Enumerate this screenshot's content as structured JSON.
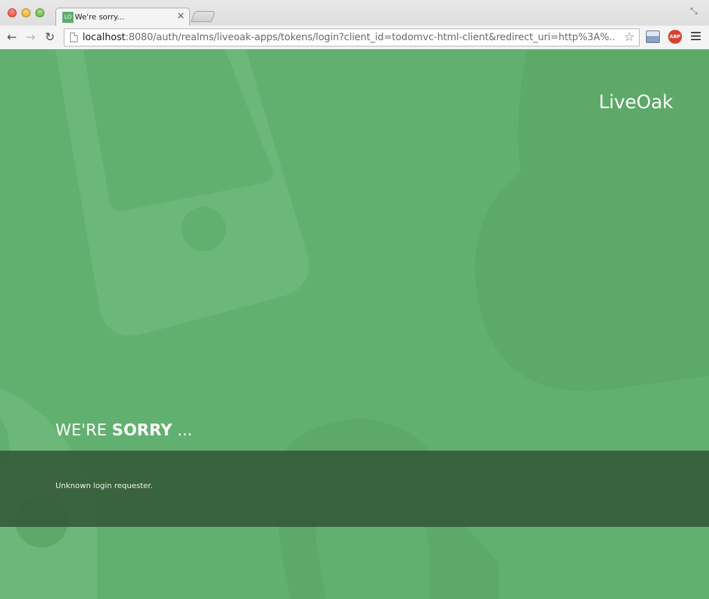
{
  "browser": {
    "tab": {
      "favicon_text": "LO",
      "title": "We're sorry...",
      "close_glyph": "×"
    },
    "toolbar": {
      "url_host": "localhost",
      "url_rest": ":8080/auth/realms/liveoak-apps/tokens/login?client_id=todomvc-html-client&redirect_uri=http%3A%...",
      "back_icon": "←",
      "forward_icon": "→",
      "reload_icon": "↻",
      "bookmark_icon": "☆",
      "abp_label": "ABP",
      "restore_icon": "⤡"
    }
  },
  "page": {
    "brand": "LiveOak",
    "heading_prefix": "WE'RE ",
    "heading_bold": "SORRY",
    "heading_suffix": " ...",
    "message": "Unknown login requester."
  },
  "colors": {
    "background": "#62b06f",
    "band": "#3a6a44",
    "text": "#ffffff"
  }
}
